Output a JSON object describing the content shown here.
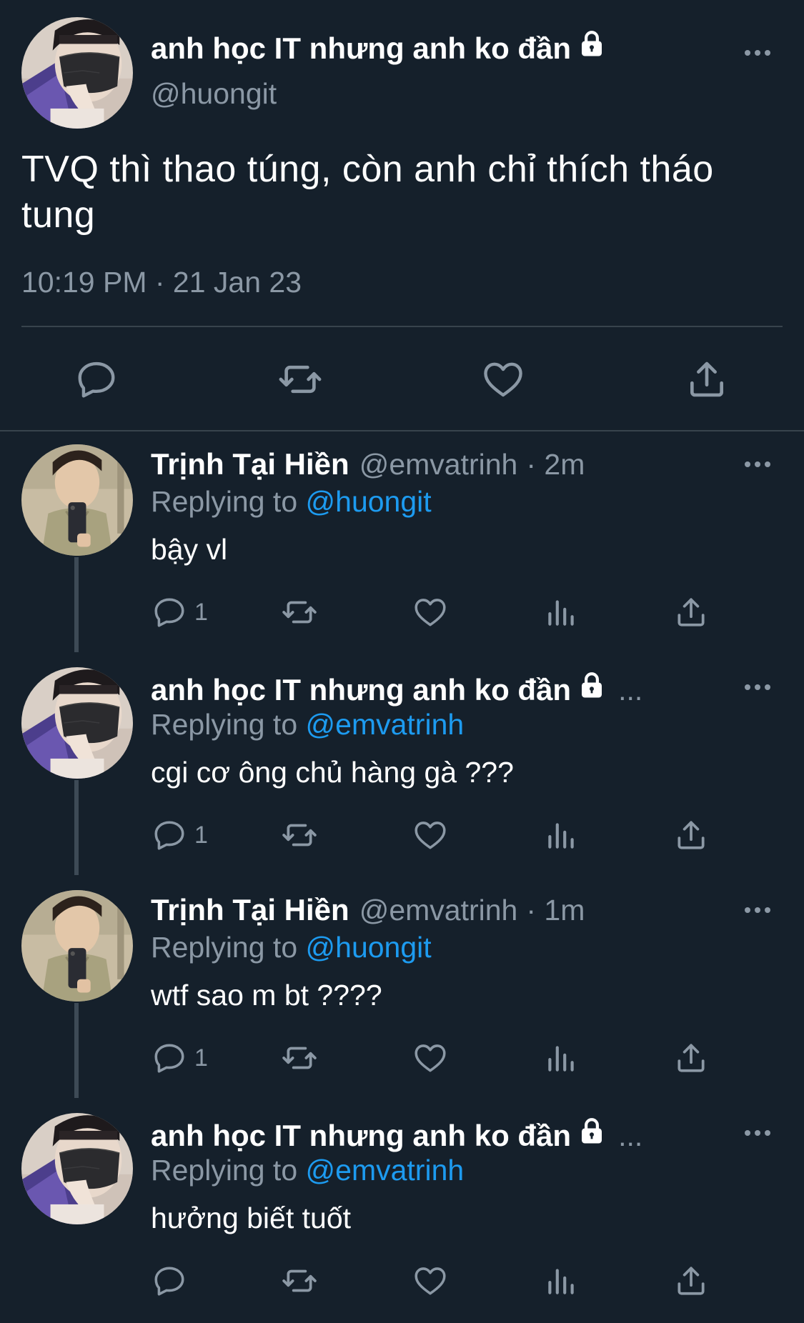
{
  "main_tweet": {
    "display_name": "anh học IT nhưng anh ko đần",
    "handle": "@huongit",
    "text": "TVQ thì thao túng, còn anh chỉ thích tháo tung",
    "timestamp": "10:19 PM · 21 Jan 23",
    "actions": [
      "reply-icon",
      "retweet-icon",
      "like-icon",
      "share-icon"
    ]
  },
  "replies": [
    {
      "display_name": "Trịnh Tại Hiền",
      "handle": "@emvatrinh",
      "time": "· 2m",
      "replying_prefix": "Replying to",
      "replying_to": "@huongit",
      "text": "bậy vl",
      "reply_count": "1",
      "locked": false
    },
    {
      "display_name": "anh học IT nhưng anh ko đần",
      "handle": "",
      "time": "...",
      "replying_prefix": "Replying to",
      "replying_to": "@emvatrinh",
      "text": "cgi cơ ông chủ hàng gà ???",
      "reply_count": "1",
      "locked": true
    },
    {
      "display_name": "Trịnh Tại Hiền",
      "handle": "@emvatrinh",
      "time": "· 1m",
      "replying_prefix": "Replying to",
      "replying_to": "@huongit",
      "text": "wtf sao m bt ????",
      "reply_count": "1",
      "locked": false
    },
    {
      "display_name": "anh học IT nhưng anh ko đần",
      "handle": "",
      "time": "...",
      "replying_prefix": "Replying to",
      "replying_to": "@emvatrinh",
      "text": "hưởng biết tuốt",
      "reply_count": "",
      "locked": true
    }
  ],
  "colors": {
    "background": "#15202b",
    "text_primary": "#ffffff",
    "text_secondary": "#8b98a5",
    "accent_link": "#1d9bf0",
    "divider": "#38444d"
  }
}
